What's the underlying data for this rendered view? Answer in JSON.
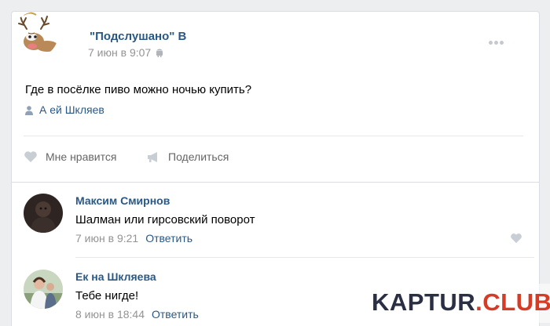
{
  "post": {
    "author": "\"Подслушано\" В",
    "time": "7 июн в 9:07",
    "text": "Где в посёлке пиво можно ночью купить?",
    "signer": "А       ей Шкляев",
    "actions": {
      "like_label": "Мне нравится",
      "share_label": "Поделиться"
    }
  },
  "comments": [
    {
      "name": "Максим Смирнов",
      "text": "Шалман или гирсовский поворот",
      "time": "7 июн в 9:21",
      "reply_label": "Ответить"
    },
    {
      "name": "Ек         на Шкляева",
      "text": "Тебе нигде!",
      "time": "8 июн в 18:44",
      "reply_label": "Ответить"
    }
  ],
  "watermark": {
    "part1": "KAPTUR",
    "part2": ".CLUB"
  },
  "colors": {
    "link": "#2a5885",
    "meta": "#939393",
    "watermark_accent": "#d53b25"
  }
}
